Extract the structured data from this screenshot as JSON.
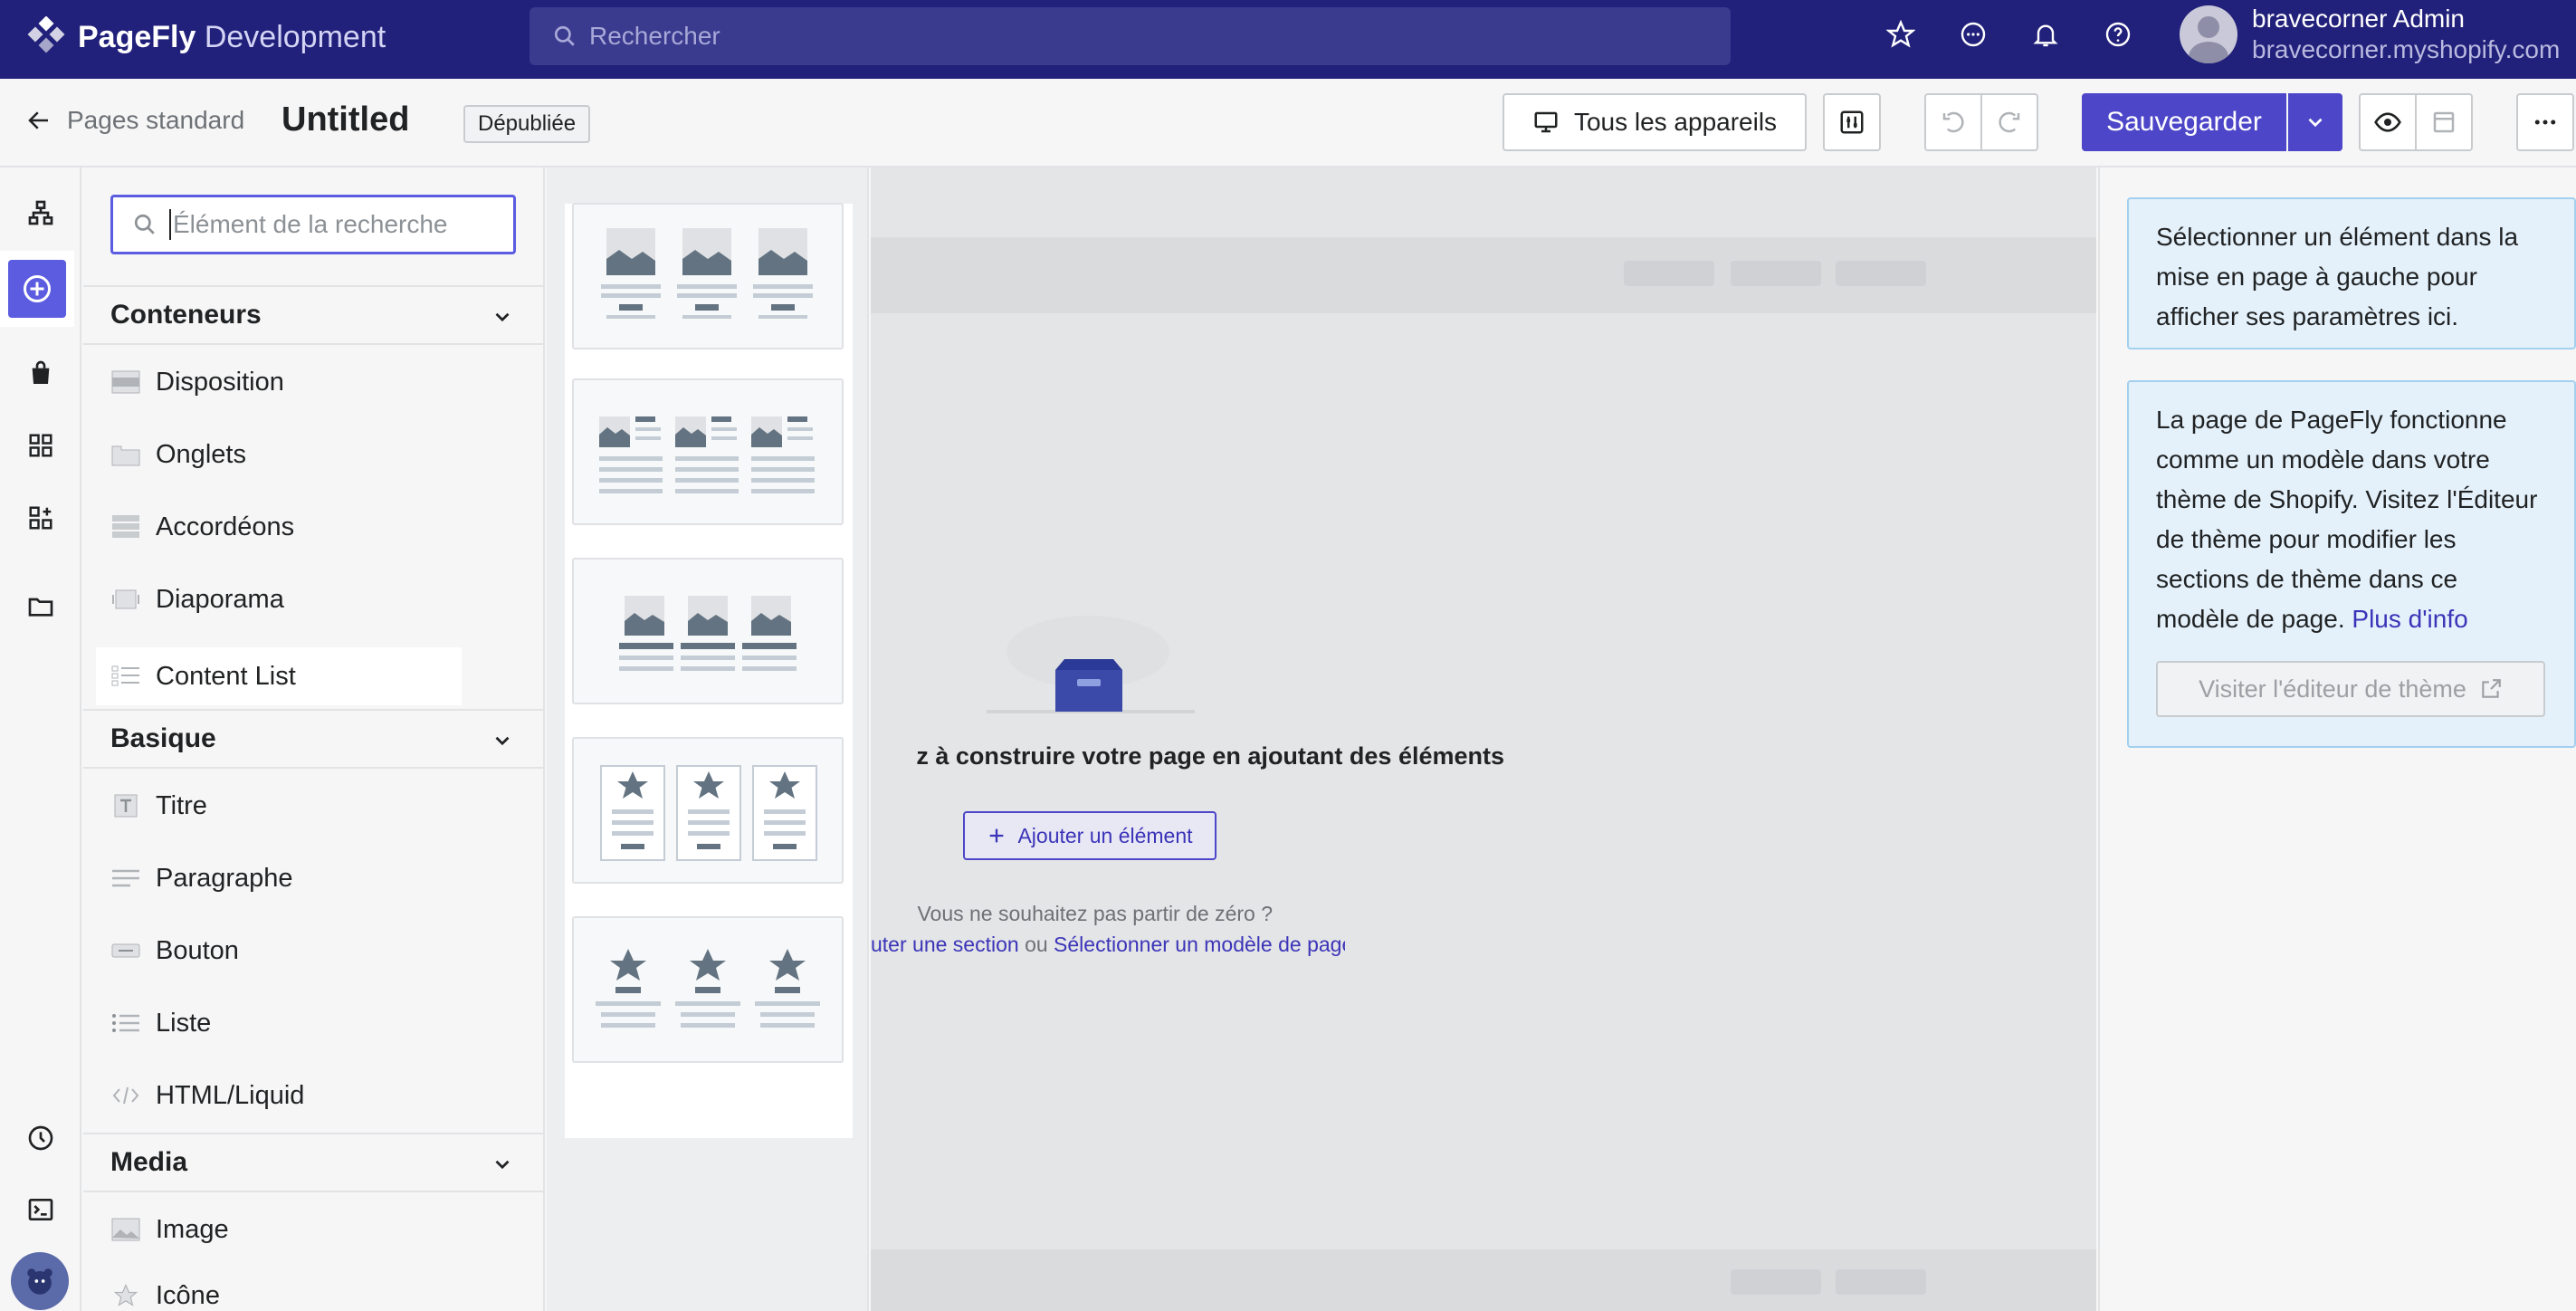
{
  "app": {
    "brand": "PageFly",
    "env": "Development",
    "search_placeholder": "Rechercher"
  },
  "user": {
    "name": "bravecorner Admin",
    "shop": "bravecorner.myshopify.com"
  },
  "toolbar": {
    "back_label": "Pages standard",
    "page_title": "Untitled",
    "status_badge": "Dépubliée",
    "devices_label": "Tous les appareils",
    "save_label": "Sauvegarder"
  },
  "panel": {
    "search_placeholder": "Élément de la recherche",
    "sections": [
      {
        "title": "Conteneurs",
        "items": [
          "Disposition",
          "Onglets",
          "Accordéons",
          "Diaporama",
          "Content List"
        ]
      },
      {
        "title": "Basique",
        "items": [
          "Titre",
          "Paragraphe",
          "Bouton",
          "Liste",
          "HTML/Liquid"
        ]
      },
      {
        "title": "Media",
        "items": [
          "Image",
          "Icône"
        ]
      }
    ]
  },
  "canvas": {
    "empty_title": "z à construire votre page en ajoutant des éléments",
    "add_element": "Ajouter un élément",
    "hint": "Vous ne souhaitez pas partir de zéro ?",
    "link_section": "uter une section",
    "link_or": "ou",
    "link_template": "Sélectionner un modèle de page"
  },
  "right": {
    "info1": "Sélectionner un élément dans la mise en page à gauche pour afficher ses paramètres ici.",
    "info2": "La page de PageFly fonctionne comme un modèle dans votre thème de Shopify. Visitez l'Éditeur de thème pour modifier les sections de thème dans ce modèle de page.",
    "info2_link": "Plus d'info",
    "theme_button": "Visiter l'éditeur de thème"
  },
  "colors": {
    "topbar": "#21207a",
    "accent": "#4d46c8",
    "info_bg": "#e4f1fb"
  }
}
